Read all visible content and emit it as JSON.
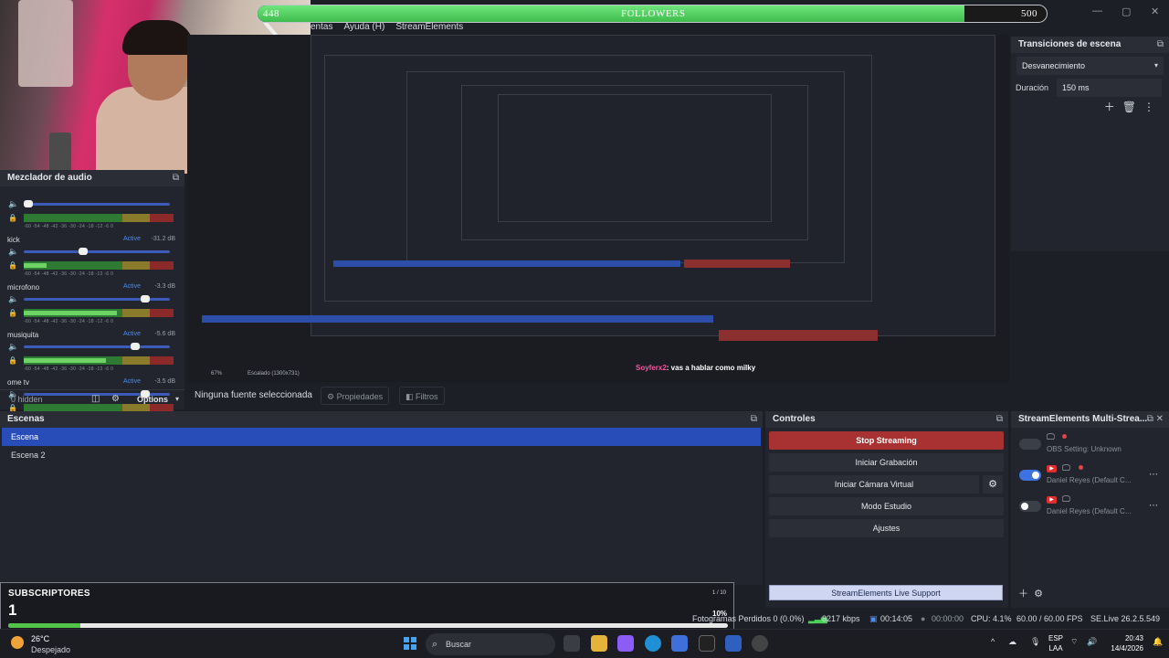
{
  "followers": {
    "current": "448",
    "goal": "500",
    "label": "FOLLOWERS",
    "progress": 0.896
  },
  "menubar": {
    "items": [
      "entas",
      "Ayuda (H)",
      "StreamElements"
    ]
  },
  "mixer": {
    "title": "Mezclador de audio",
    "channels": [
      {
        "name": "",
        "status": "",
        "db": "",
        "volume": 0.0,
        "level": 0.0
      },
      {
        "name": "kick",
        "status": "Active",
        "db": "-31.2 dB",
        "volume": 0.4,
        "level": 0.15
      },
      {
        "name": "microfono",
        "status": "Active",
        "db": "-3.3 dB",
        "volume": 0.85,
        "level": 0.62
      },
      {
        "name": "musiquita",
        "status": "Active",
        "db": "-5.6 dB",
        "volume": 0.78,
        "level": 0.55
      },
      {
        "name": "ome tv",
        "status": "Active",
        "db": "-3.5 dB",
        "volume": 0.85,
        "level": 0.0
      }
    ],
    "scale": "-60 -54 -48 -42 -36 -30 -24 -18 -12 -6 0",
    "hidden": "0 hidden",
    "options": "Options"
  },
  "source_toolbar": {
    "no_source": "Ninguna fuente seleccionada",
    "properties": "Propiedades",
    "filters": "Filtros"
  },
  "scenes": {
    "title": "Escenas",
    "items": [
      "Escena",
      "Escena 2"
    ]
  },
  "controls": {
    "title": "Controles",
    "stop_streaming": "Stop Streaming",
    "start_recording": "Iniciar Grabación",
    "virtual_camera": "Iniciar Cámara Virtual",
    "studio_mode": "Modo Estudio",
    "settings": "Ajustes",
    "support": "StreamElements Live Support"
  },
  "multistream": {
    "title": "StreamElements Multi-Strea...",
    "rows": [
      {
        "text": "OBS Setting: Unknown",
        "on": false
      },
      {
        "text": "Daniel Reyes (Default C...",
        "on": true
      },
      {
        "text": "Daniel Reyes (Default C...",
        "on": false
      }
    ]
  },
  "transitions": {
    "title": "Transiciones de escena",
    "type": "Desvanecimiento",
    "duration_label": "Duración",
    "duration_value": "150 ms"
  },
  "subscribers": {
    "title": "SUBSCRIPTORES",
    "count": "1",
    "page": "1 / 10",
    "percent": "10%",
    "progress": 0.1
  },
  "status": {
    "dropped": "Fotogramas Perdidos 0 (0.0%)",
    "kbps": "8217 kbps",
    "stream_time": "00:14:05",
    "rec_time": "00:00:00",
    "cpu": "CPU: 4.1%",
    "fps": "60.00 / 60.00 FPS",
    "version": "SE.Live 26.2.5.549"
  },
  "chat": {
    "user": "Soyferx2",
    "message": ": vas a hablar como milky"
  },
  "preview": {
    "zoom": "67%",
    "scale": "Escalado (1300x731)"
  },
  "taskbar": {
    "temp": "26°C",
    "weather": "Despejado",
    "search": "Buscar",
    "lang1": "ESP",
    "lang2": "LAA",
    "time": "20:43",
    "date": "14/4/2026"
  }
}
